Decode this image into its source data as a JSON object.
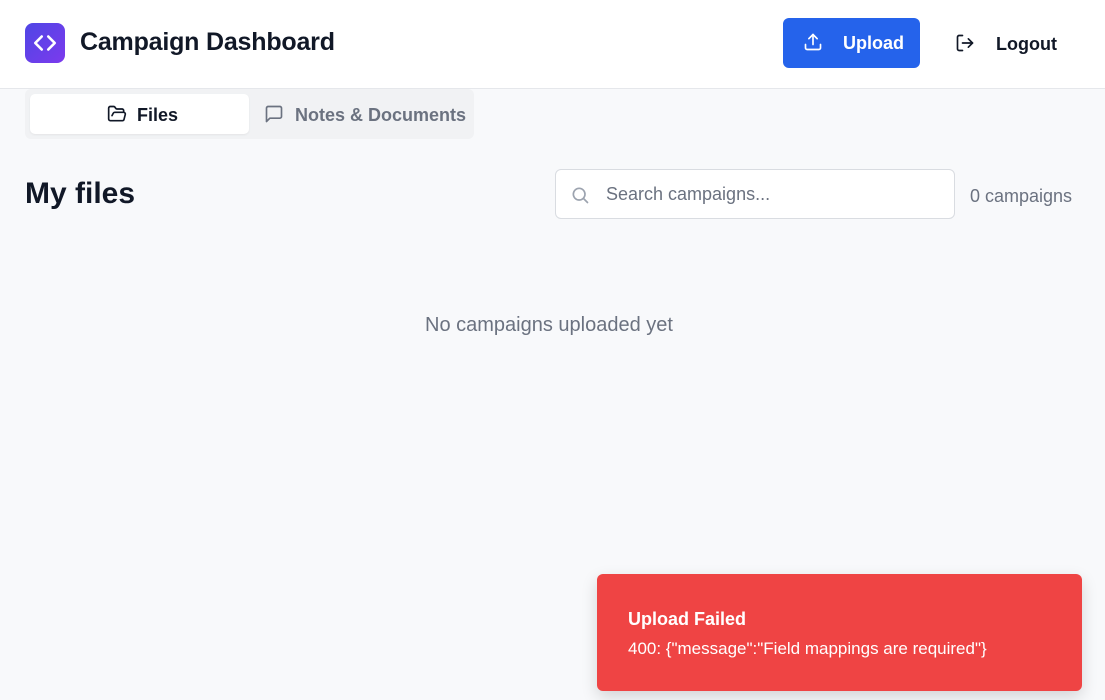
{
  "header": {
    "title": "Campaign Dashboard",
    "logo_icon": "code-brackets-icon",
    "upload_label": "Upload",
    "logout_label": "Logout"
  },
  "tabs": [
    {
      "label": "Files",
      "icon": "folder-open-icon",
      "active": true
    },
    {
      "label": "Notes & Documents",
      "icon": "message-square-icon",
      "active": false
    }
  ],
  "main": {
    "title": "My files",
    "search": {
      "placeholder": "Search campaigns...",
      "value": ""
    },
    "count": "0 campaigns",
    "empty_message": "No campaigns uploaded yet"
  },
  "toast": {
    "title": "Upload Failed",
    "message": "400: {\"message\":\"Field mappings are required\"}"
  },
  "colors": {
    "primary": "#2563eb",
    "logo_gradient_start": "#4f46e5",
    "logo_gradient_end": "#7c3aed",
    "error": "#ef4444"
  }
}
